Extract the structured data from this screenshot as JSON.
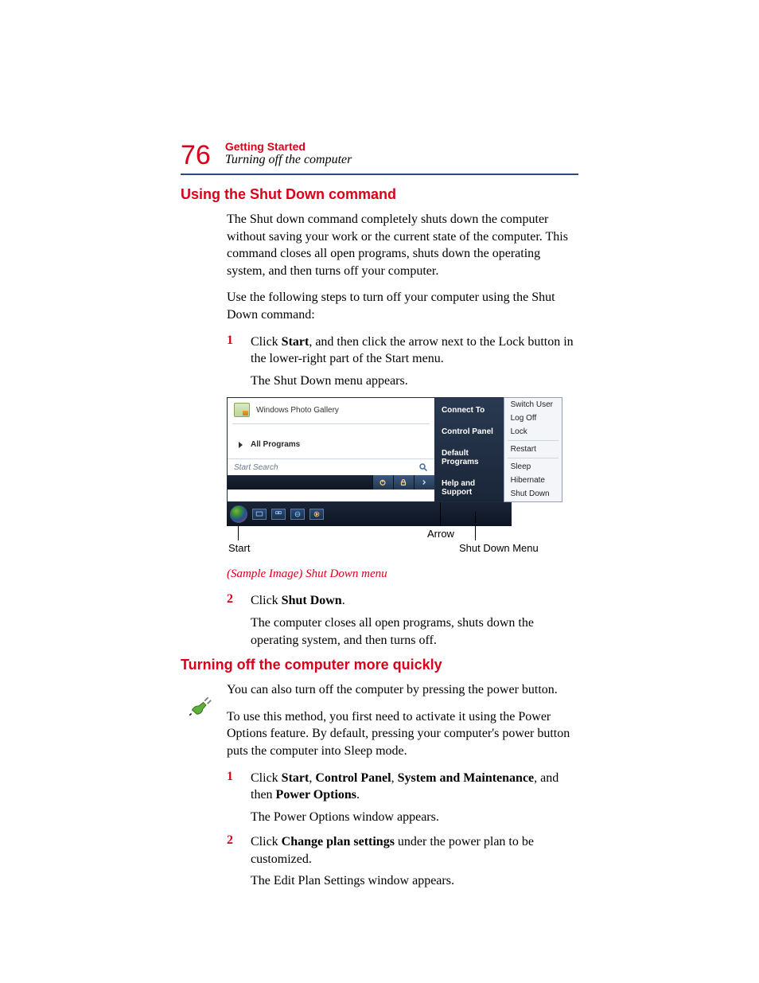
{
  "header": {
    "page_number": "76",
    "chapter": "Getting Started",
    "section": "Turning off the computer"
  },
  "h2_a": "Using the Shut Down command",
  "para1": "The Shut down command completely shuts down the computer without saving your work or the current state of the computer. This command closes all open programs, shuts down the operating system, and then turns off your computer.",
  "para2": "Use the following steps to turn off your computer using the Shut Down command:",
  "step1": {
    "num": "1",
    "pre": "Click ",
    "b1": "Start",
    "post": ", and then click the arrow next to the Lock button in the lower-right part of the Start menu."
  },
  "step1_cont": "The Shut Down menu appears.",
  "screenshot": {
    "wpg": "Windows Photo Gallery",
    "all_programs": "All Programs",
    "search_placeholder": "Start Search",
    "right": {
      "connect": "Connect To",
      "control": "Control Panel",
      "defaults": "Default Programs",
      "help": "Help and Support"
    },
    "menu": {
      "switch": "Switch User",
      "logoff": "Log Off",
      "lock": "Lock",
      "restart": "Restart",
      "sleep": "Sleep",
      "hibernate": "Hibernate",
      "shutdown": "Shut Down"
    },
    "callouts": {
      "start": "Start",
      "arrow": "Arrow",
      "menu": "Shut Down Menu"
    }
  },
  "caption1": "(Sample Image) Shut Down menu",
  "step2": {
    "num": "2",
    "pre": "Click ",
    "b1": "Shut Down",
    "post": "."
  },
  "step2_cont": "The computer closes all open programs, shuts down the operating system, and then turns off.",
  "h2_b": "Turning off the computer more quickly",
  "para3": "You can also turn off the computer by pressing the power button.",
  "para4": "To use this method, you first need to activate it using the Power Options feature. By default, pressing your computer's power button puts the computer into Sleep mode.",
  "stepB1": {
    "num": "1",
    "pre": "Click ",
    "b1": "Start",
    "mid1": ", ",
    "b2": "Control Panel",
    "mid2": ", ",
    "b3": "System and Maintenance",
    "mid3": ", and then ",
    "b4": "Power Options",
    "post": "."
  },
  "stepB1_cont": "The Power Options window appears.",
  "stepB2": {
    "num": "2",
    "pre": "Click ",
    "b1": "Change plan settings",
    "post": " under the power plan to be customized."
  },
  "stepB2_cont": "The Edit Plan Settings window appears."
}
